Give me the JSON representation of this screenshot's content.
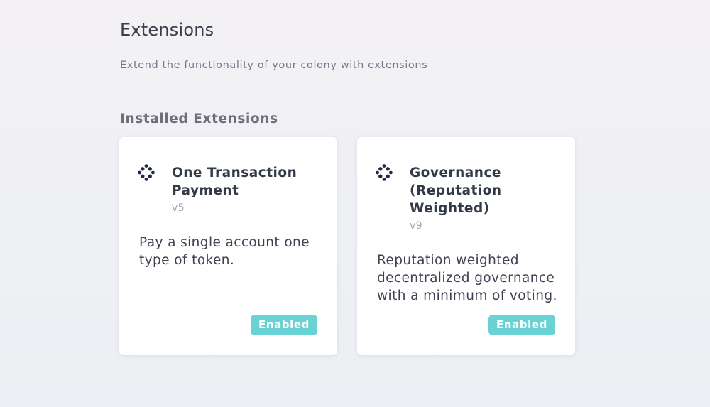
{
  "header": {
    "title": "Extensions",
    "subtitle": "Extend the functionality of your colony with extensions"
  },
  "installed": {
    "section_title": "Installed Extensions",
    "extensions": [
      {
        "name": "One Transaction Payment",
        "version": "v5",
        "description": "Pay a single account one type of token.",
        "status": "Enabled",
        "icon": "colony-logo-icon"
      },
      {
        "name": "Governance (Reputation Weighted)",
        "version": "v9",
        "description": "Reputation weighted decentralized governance with a minimum of voting.",
        "status": "Enabled",
        "icon": "colony-logo-icon"
      }
    ]
  },
  "colors": {
    "badge_enabled": "#68d2d4",
    "icon": "#1d2b45"
  }
}
